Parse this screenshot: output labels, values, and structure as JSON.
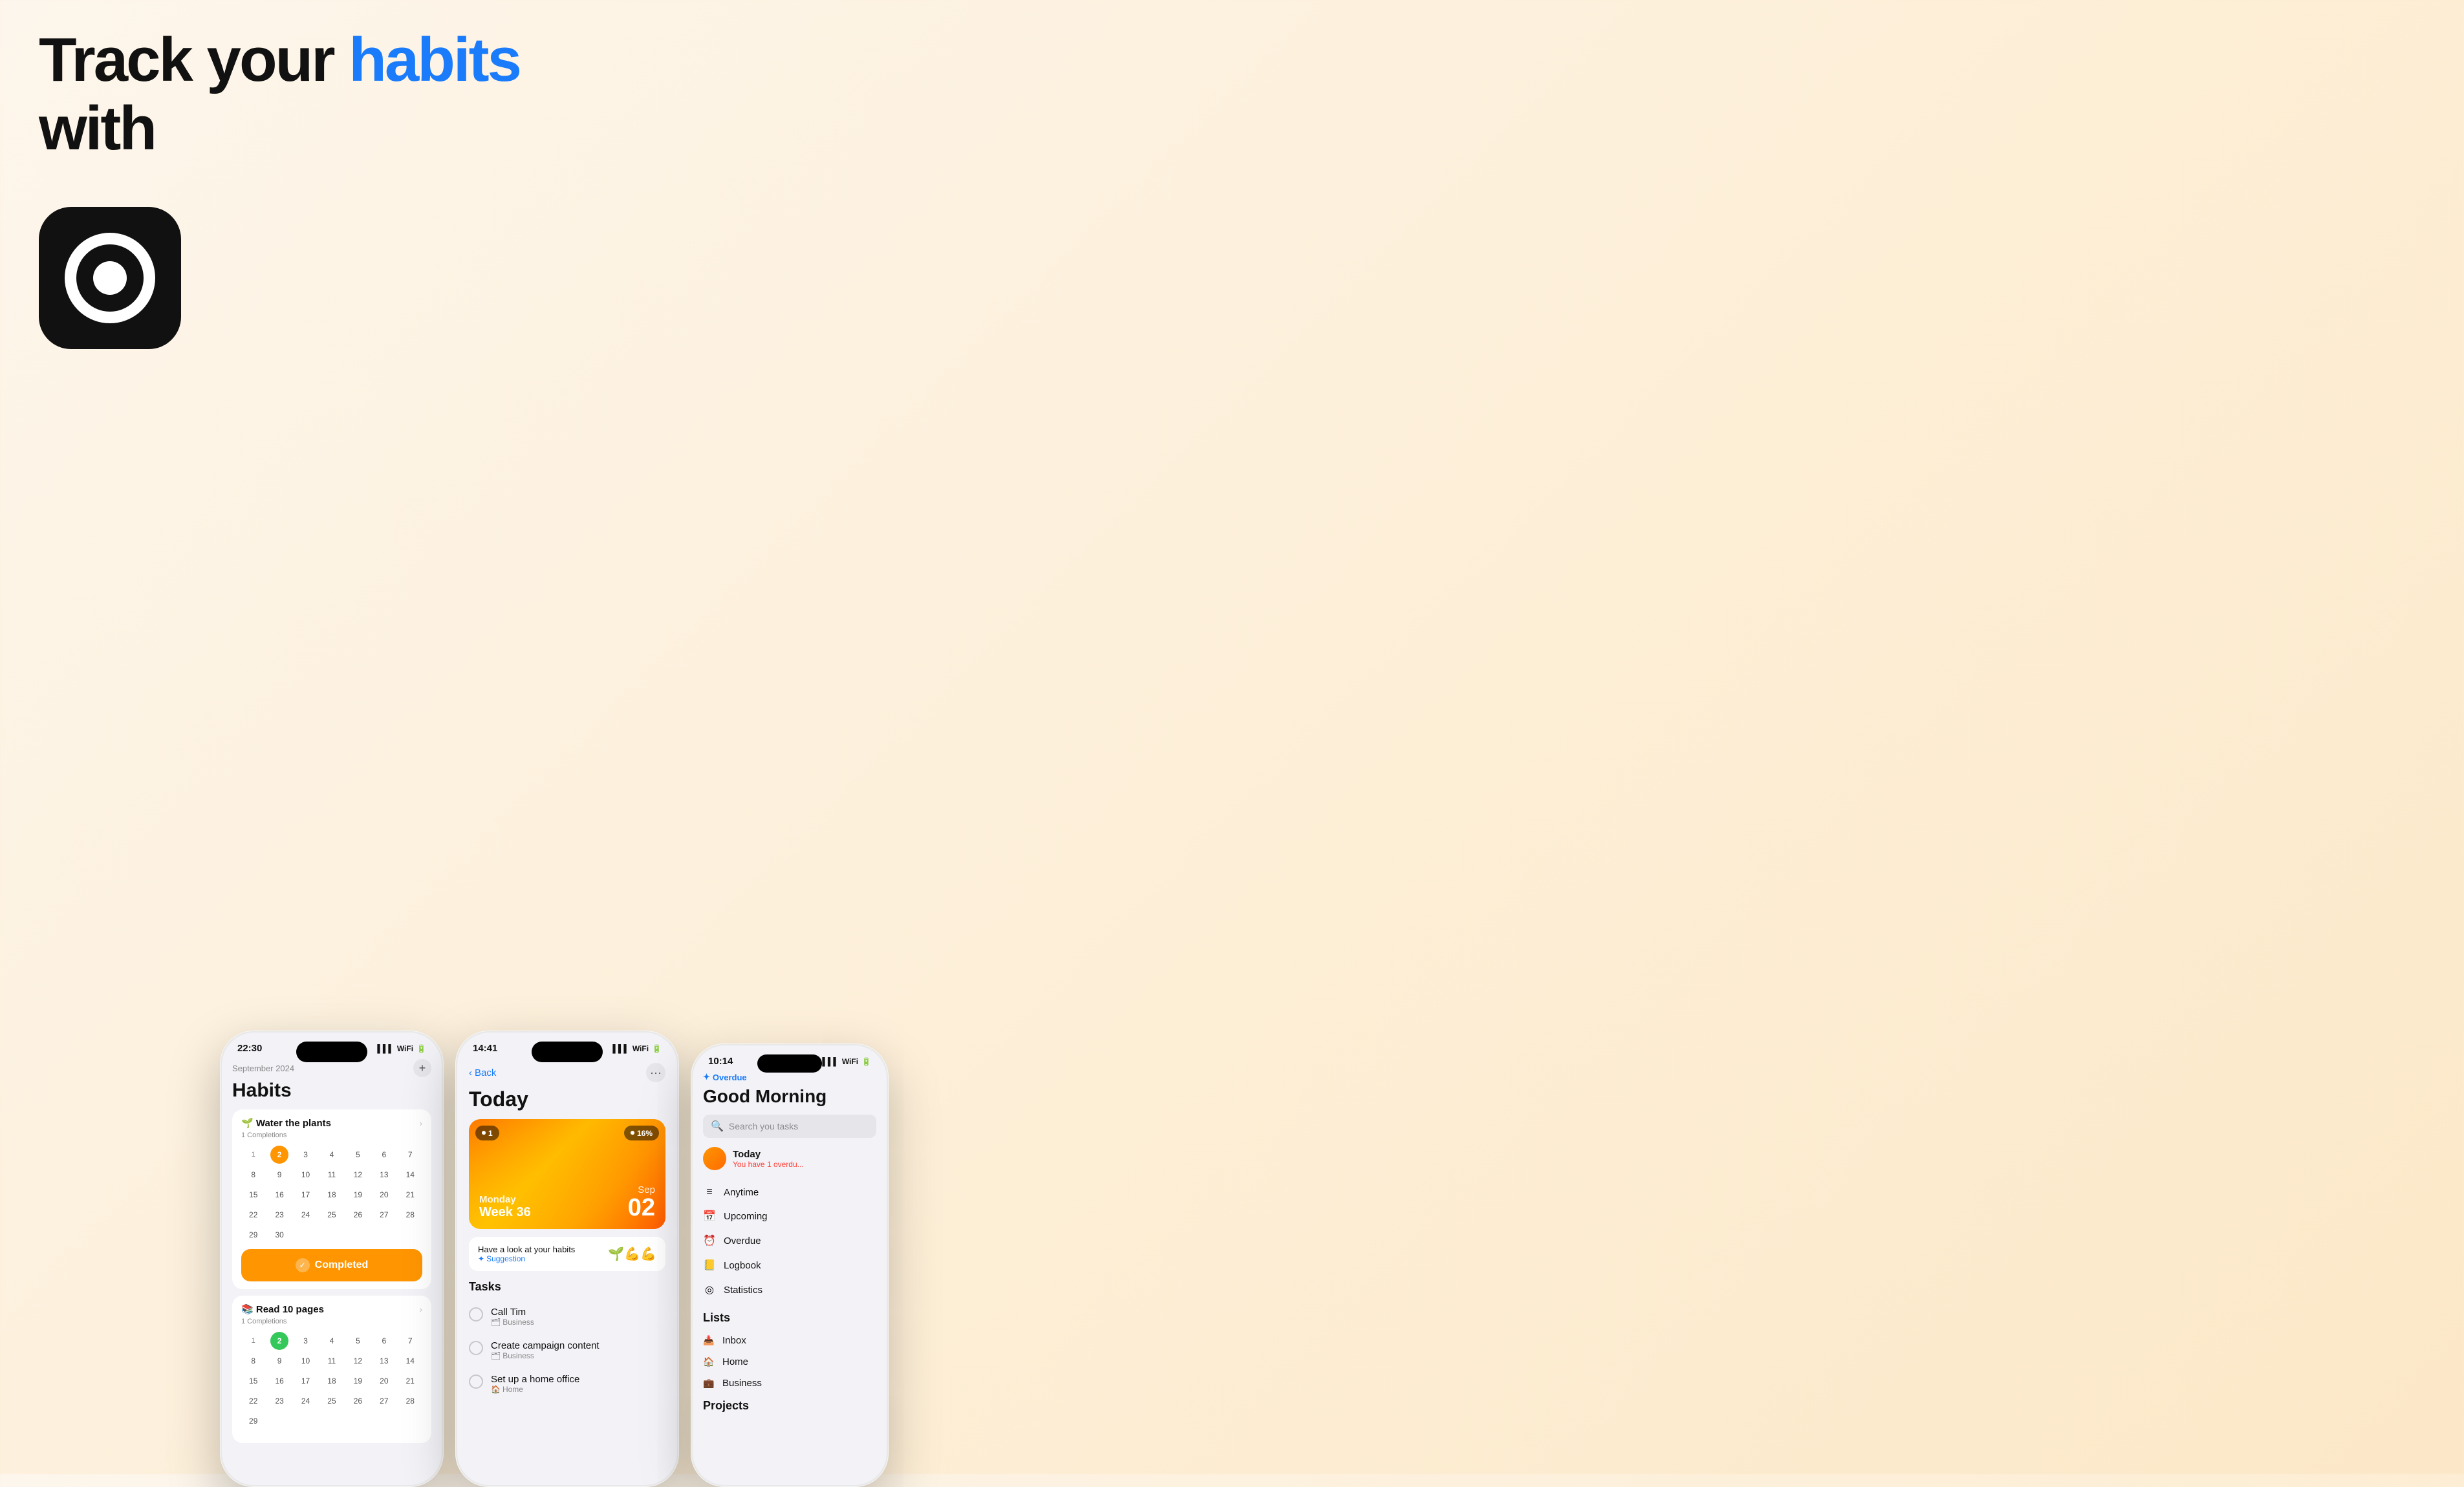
{
  "hero": {
    "line1": "Track your ",
    "line1_blue": "habits",
    "line2": "with"
  },
  "phone1": {
    "status_time": "22:30",
    "month": "September 2024",
    "title": "Habits",
    "habit1": {
      "name": "Water the plants",
      "emoji": "🌱",
      "completions": "1 Completions",
      "active_day": "2"
    },
    "habit2": {
      "name": "Read 10 pages",
      "emoji": "📚",
      "completions": "1 Completions",
      "active_day": "2"
    },
    "completed_btn": "Completed",
    "calendar_days": [
      "2",
      "3",
      "4",
      "5",
      "6",
      "7",
      "8",
      "9",
      "10",
      "11",
      "12",
      "13",
      "14",
      "15",
      "16",
      "17",
      "18",
      "19",
      "20",
      "21",
      "22",
      "23",
      "24",
      "25",
      "26",
      "27",
      "28",
      "29",
      "30"
    ]
  },
  "phone2": {
    "status_time": "14:41",
    "back_label": "Back",
    "title": "Today",
    "hero": {
      "day": "Monday",
      "week": "Week 36",
      "month": "Sep",
      "date": "02",
      "badge_left": "1",
      "badge_right": "16%"
    },
    "suggestion": {
      "text": "Have a look at your habits",
      "link": "Suggestion",
      "emojis": "🌱💪💪"
    },
    "tasks_title": "Tasks",
    "tasks": [
      {
        "name": "Call Tim",
        "category": "Business"
      },
      {
        "name": "Create campaign content",
        "category": "Business"
      },
      {
        "name": "Set up a home office",
        "category": "Home"
      }
    ]
  },
  "phone3": {
    "status_time": "10:14",
    "overdue_label": "Overdue",
    "title": "Good Morning",
    "search_placeholder": "Search you tasks",
    "today_label": "Today",
    "today_sub": "You have 1 overdu...",
    "nav_items": [
      {
        "icon": "≡",
        "label": "Anytime"
      },
      {
        "icon": "□",
        "label": "Upcoming"
      },
      {
        "icon": "⏰",
        "label": "Overdue"
      },
      {
        "icon": "▤",
        "label": "Logbook"
      },
      {
        "icon": "◎",
        "label": "Statistics"
      }
    ],
    "lists_title": "Lists",
    "lists": [
      {
        "icon": "📥",
        "label": "Inbox"
      },
      {
        "icon": "🏠",
        "label": "Home"
      },
      {
        "icon": "💼",
        "label": "Business"
      }
    ],
    "projects_title": "Projects"
  }
}
